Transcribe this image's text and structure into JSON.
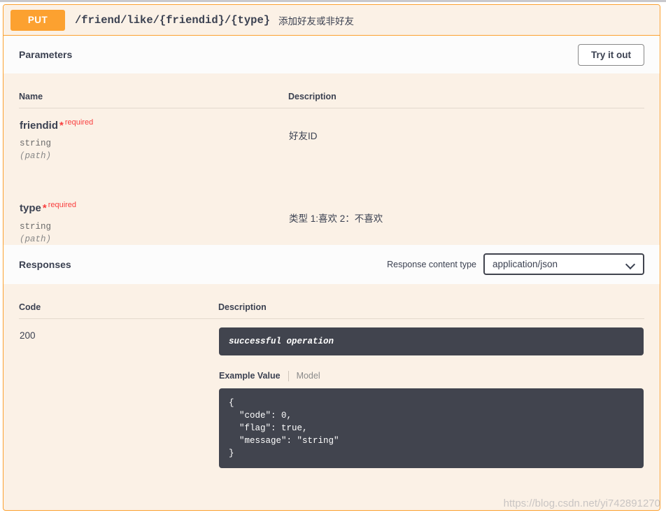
{
  "operation": {
    "method": "PUT",
    "path": "/friend/like/{friendid}/{type}",
    "summary": "添加好友或非好友"
  },
  "parameters_section": {
    "title": "Parameters",
    "try_it_out_label": "Try it out",
    "columns": {
      "name": "Name",
      "description": "Description"
    },
    "rows": [
      {
        "name": "friendid",
        "required_marker": "*",
        "required_label": "required",
        "type": "string",
        "in": "(path)",
        "description": "好友ID"
      },
      {
        "name": "type",
        "required_marker": "*",
        "required_label": "required",
        "type": "string",
        "in": "(path)",
        "description": "类型 1:喜欢 2：不喜欢"
      }
    ]
  },
  "responses_section": {
    "title": "Responses",
    "content_type_label": "Response content type",
    "content_type_value": "application/json",
    "chevron_icon": "chevron-down-icon",
    "columns": {
      "code": "Code",
      "description": "Description"
    },
    "rows": [
      {
        "code": "200",
        "description": "successful operation",
        "example_tab_label": "Example Value",
        "model_tab_label": "Model",
        "example_value": "{\n  \"code\": 0,\n  \"flag\": true,\n  \"message\": \"string\"\n}"
      }
    ]
  },
  "watermark": "https://blog.csdn.net/yi742891270",
  "colors": {
    "method_put": "#fca130",
    "block_border": "#fca130",
    "block_bg": "#fbf1e6",
    "section_head_bg": "#fcfcfc",
    "dark_box": "#41444e",
    "required_red": "#f93e3e",
    "text": "#3b4151"
  }
}
